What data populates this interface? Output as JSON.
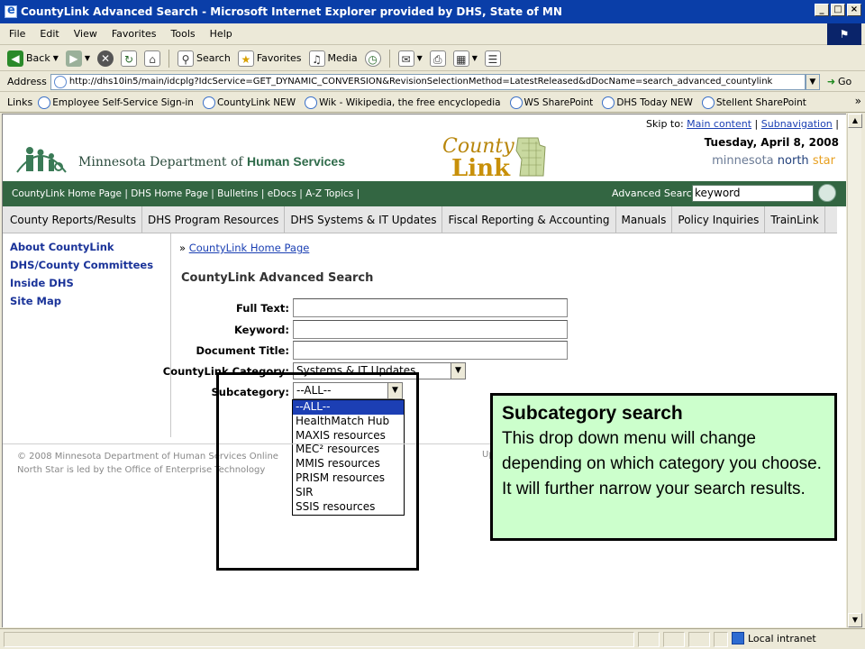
{
  "window": {
    "title": "CountyLink Advanced Search - Microsoft Internet Explorer provided by DHS, State of MN",
    "controls": [
      "_",
      "□",
      "×"
    ]
  },
  "menubar": [
    "File",
    "Edit",
    "View",
    "Favorites",
    "Tools",
    "Help"
  ],
  "toolbar": {
    "back": "Back",
    "search": "Search",
    "favorites": "Favorites",
    "media": "Media"
  },
  "address": {
    "label": "Address",
    "url": "http://dhs10in5/main/idcplg?IdcService=GET_DYNAMIC_CONVERSION&RevisionSelectionMethod=LatestReleased&dDocName=search_advanced_countylink",
    "go": "Go"
  },
  "links": {
    "label": "Links",
    "items": [
      "Employee Self-Service Sign-in",
      "CountyLink NEW",
      "Wik - Wikipedia, the free encyclopedia",
      "WS SharePoint",
      "DHS Today NEW",
      "Stellent SharePoint"
    ],
    "more": "»"
  },
  "page": {
    "skip_prefix": "Skip to:",
    "skip_main": "Main content",
    "skip_sep1": "|",
    "skip_sub": "Subnavigation",
    "skip_sep2": "|",
    "date": "Tuesday, April 8, 2008",
    "northstar_a": "minnesota",
    "northstar_b": "north",
    "northstar_c": "star",
    "dept_prefix": "Minnesota Department of",
    "dept_bold": "Human Services",
    "logo_county": "County",
    "logo_link": "Link",
    "green_links": "CountyLink Home Page | DHS Home Page | Bulletins | eDocs | A-Z Topics |",
    "adv_search_label": "Advanced Search",
    "keyword_value": "keyword",
    "tabs": [
      "County Reports/Results",
      "DHS Program Resources",
      "DHS Systems & IT Updates",
      "Fiscal Reporting & Accounting",
      "Manuals",
      "Policy Inquiries",
      "TrainLink"
    ],
    "leftnav": [
      "About CountyLink",
      "DHS/County Committees",
      "Inside DHS",
      "Site Map"
    ],
    "breadcrumb_prefix": "»",
    "breadcrumb_link": "CountyLink Home Page",
    "form_title": "CountyLink Advanced Search",
    "fields": {
      "full_text": "Full Text:",
      "keyword": "Keyword:",
      "doc_title": "Document Title:",
      "category": "CountyLink Category:",
      "category_value": "Systems & IT Updates",
      "subcategory": "Subcategory:",
      "subcategory_value": "--ALL--"
    },
    "subcategory_options": [
      "--ALL--",
      "HealthMatch Hub",
      "MAXIS resources",
      "MEC² resources",
      "MMIS resources",
      "PRISM resources",
      "SIR",
      "SSIS resources"
    ],
    "footer_1": "© 2008 Minnesota Department of Human Services Online",
    "footer_2": "North Star is led by the Office of Enterprise Technology",
    "footer_right": "Up"
  },
  "status": {
    "zone": "Local intranet"
  },
  "callout": {
    "title": "Subcategory search",
    "body": "This drop down menu will change depending on which category you choose. It will further narrow your search results."
  },
  "colors": {
    "title_bar": "#0a3ea8",
    "green_bar": "#336642",
    "callout_bg": "#ccffcc",
    "selected_option": "#1c3fb4"
  }
}
